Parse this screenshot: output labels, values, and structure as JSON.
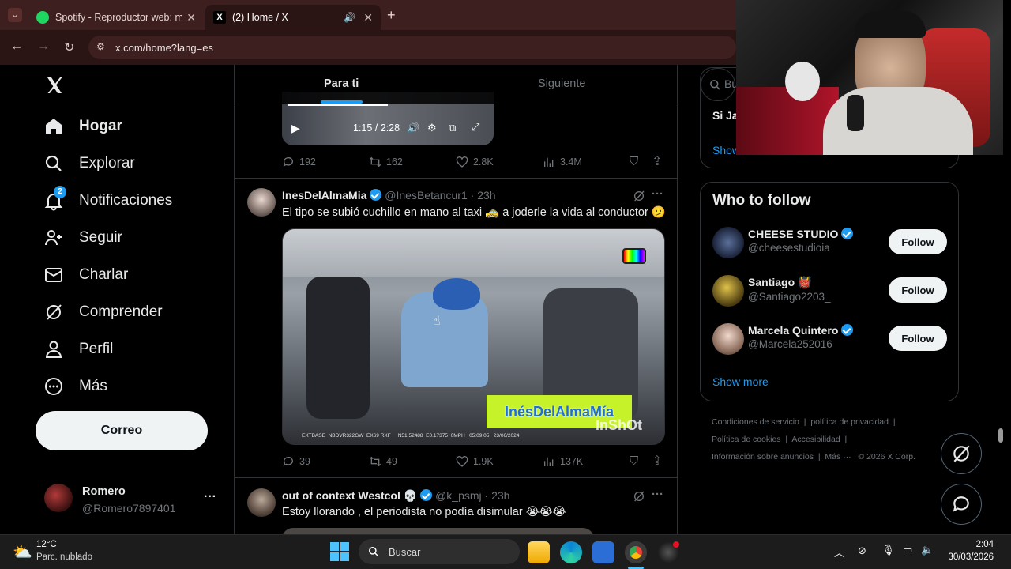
{
  "browser": {
    "tabs": [
      {
        "title": "Spotify - Reproductor web: mú",
        "close": "✕"
      },
      {
        "title": "(2) Home / X",
        "close": "✕"
      }
    ],
    "new_tab": "+",
    "url": "x.com/home?lang=es"
  },
  "nav": {
    "items": [
      {
        "label": "Hogar",
        "icon": "home-icon"
      },
      {
        "label": "Explorar",
        "icon": "search-icon"
      },
      {
        "label": "Notificaciones",
        "icon": "bell-icon",
        "badge": "2"
      },
      {
        "label": "Seguir",
        "icon": "follow-icon"
      },
      {
        "label": "Charlar",
        "icon": "mail-icon"
      },
      {
        "label": "Comprender",
        "icon": "grok-icon"
      },
      {
        "label": "Perfil",
        "icon": "person-icon"
      },
      {
        "label": "Más",
        "icon": "more-icon"
      }
    ],
    "post_button": "Correo",
    "account": {
      "name": "Romero",
      "handle": "@Romero7897401",
      "more": "···"
    }
  },
  "feed": {
    "tabs": [
      "Para ti",
      "Siguiente"
    ],
    "video": {
      "time": "1:15 / 2:28"
    },
    "post0_metrics": {
      "replies": "192",
      "reposts": "162",
      "likes": "2.8K",
      "views": "3.4M"
    },
    "posts": [
      {
        "name": "InesDelAlmaMia",
        "handle": "@InesBetancur1",
        "time": "· 23h",
        "text": "El tipo se subió cuchillo en mano al taxi 🚕 a joderle la vida al conductor 🫤",
        "overlay": "InésDelAlmaMía",
        "watermark": "InShOt",
        "dashcam": "EXTBASE  NBDVR322GW  EX69 RXF     N51.52488  E0.17375  0MPH   05:09:05   23/06/2024",
        "metrics": {
          "replies": "39",
          "reposts": "49",
          "likes": "1.9K",
          "views": "137K"
        }
      },
      {
        "name": "out of context Westcol 💀",
        "handle": "@k_psmj",
        "time": "· 23h",
        "text": "Estoy llorando , el periodista no podía disimular 😭😭😭"
      }
    ]
  },
  "sidebar": {
    "search_partial": "Bu",
    "trend_partial": "Si Ja",
    "show_partial": "Show",
    "who_to_follow": {
      "title": "Who to follow",
      "users": [
        {
          "name": "CHEESE STUDIO",
          "handle": "@cheesestudioia",
          "verified": true,
          "button": "Follow"
        },
        {
          "name": "Santiago 👹",
          "handle": "@Santiago2203_",
          "verified": false,
          "button": "Follow"
        },
        {
          "name": "Marcela Quintero",
          "handle": "@Marcela252016",
          "verified": true,
          "button": "Follow"
        }
      ],
      "show_more": "Show more"
    },
    "footer": {
      "line1": [
        "Condiciones de servicio",
        "|",
        "política de privacidad",
        "|"
      ],
      "line2": [
        "Política de cookies",
        "|",
        "Accesibilidad",
        "|"
      ],
      "line3": [
        "Información sobre anuncios",
        "|",
        "Más ···",
        "© 2026 X Corp."
      ]
    }
  },
  "taskbar": {
    "weather": {
      "temp": "12°C",
      "desc": "Parc. nublado"
    },
    "search": "Buscar",
    "clock": {
      "time": "2:04",
      "date": "30/03/2026"
    }
  },
  "colors": {
    "accent": "#1d9bf0",
    "chrome": "#3c1f1e",
    "background": "#000000"
  }
}
